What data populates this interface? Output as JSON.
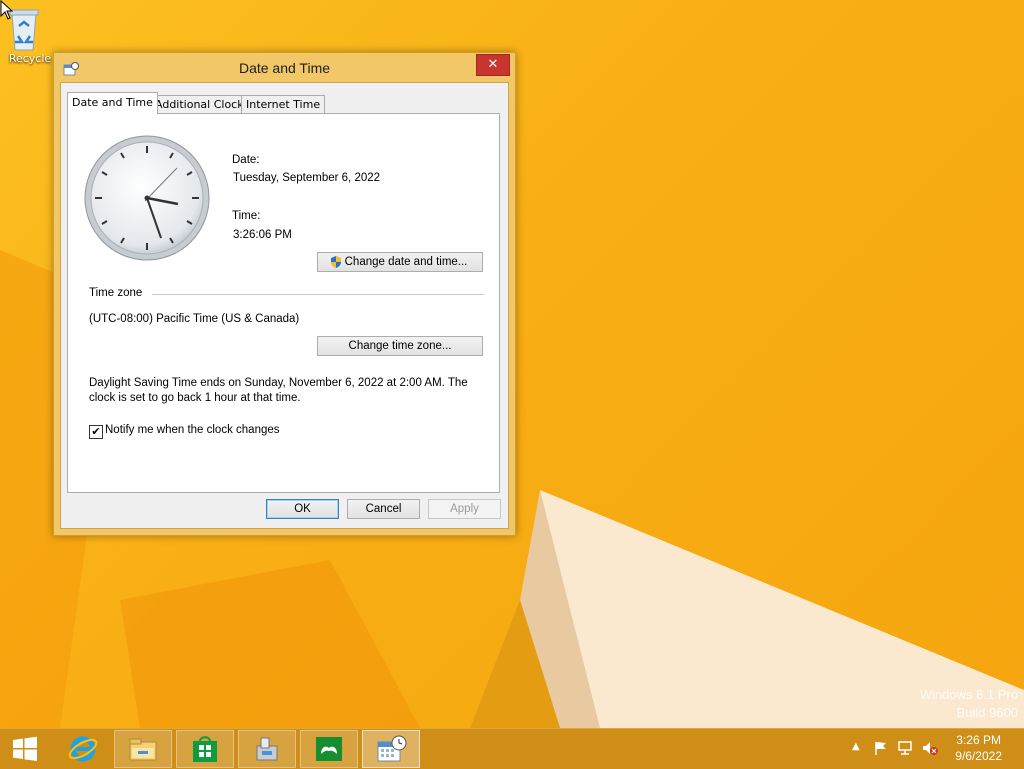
{
  "desktop": {
    "recycle_label": "Recycle",
    "watermark_line1": "Windows 8.1 Pro",
    "watermark_line2": "Build 9600"
  },
  "dialog": {
    "title": "Date and Time",
    "close_glyph": "✕",
    "tabs": [
      {
        "label": "Date and Time",
        "active": true
      },
      {
        "label": "Additional Clocks",
        "active": false
      },
      {
        "label": "Internet Time",
        "active": false
      }
    ],
    "date_label": "Date:",
    "date_value": "Tuesday, September 6, 2022",
    "time_label": "Time:",
    "time_value": "3:26:06 PM",
    "change_datetime_button": "Change date and time...",
    "timezone_heading": "Time zone",
    "timezone_value": "(UTC-08:00) Pacific Time (US & Canada)",
    "change_timezone_button": "Change time zone...",
    "dst_line1": "Daylight Saving Time ends on Sunday, November 6, 2022 at 2:00 AM. The",
    "dst_line2": "clock is set to go back 1 hour at that time.",
    "notify_label": "Notify me when the clock changes",
    "notify_checked": true,
    "ok_button": "OK",
    "cancel_button": "Cancel",
    "apply_button": "Apply"
  },
  "taskbar": {
    "items": [
      "start-icon",
      "internet-explorer-icon",
      "file-explorer-icon",
      "store-icon",
      "setup-icon",
      "xbox-games-icon",
      "date-time-icon"
    ],
    "clock_time": "3:26 PM",
    "clock_date": "9/6/2022"
  },
  "colors": {
    "desktop": "#f8b41c",
    "taskbar": "#cf8e17",
    "close_button": "#c7352e"
  }
}
